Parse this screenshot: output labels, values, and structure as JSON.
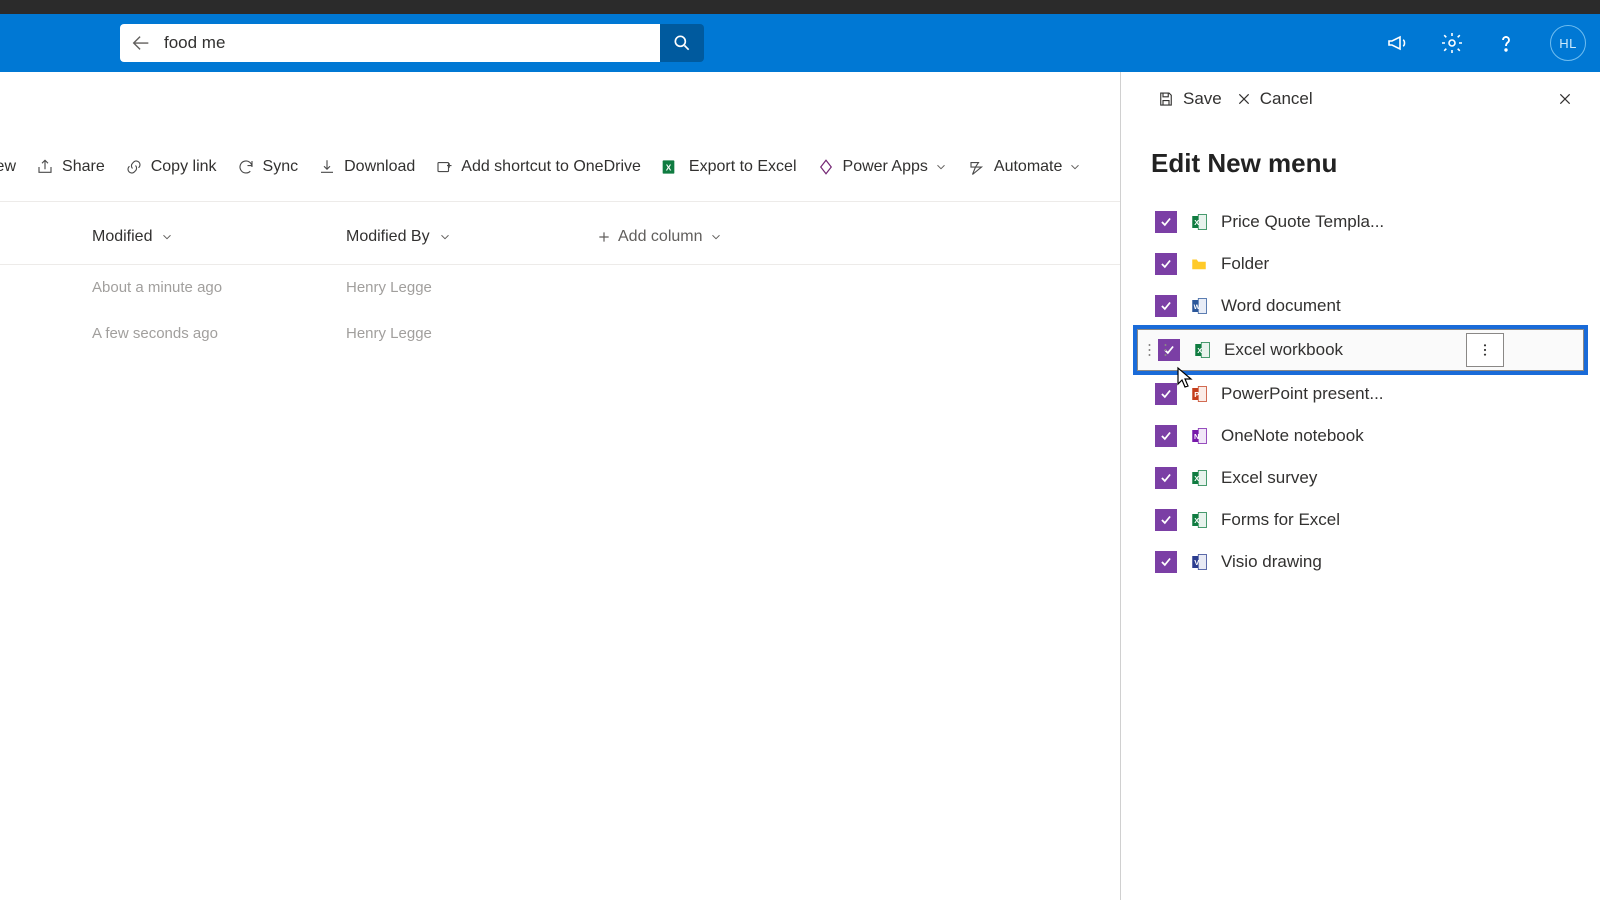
{
  "search": {
    "value": "food me"
  },
  "header": {
    "avatar": "HL"
  },
  "commands": {
    "view_partial": "iew",
    "share": "Share",
    "copy_link": "Copy link",
    "sync": "Sync",
    "download": "Download",
    "add_shortcut": "Add shortcut to OneDrive",
    "export_excel": "Export to Excel",
    "power_apps": "Power Apps",
    "automate": "Automate"
  },
  "columns": {
    "modified": "Modified",
    "modified_by": "Modified By",
    "add": "Add column"
  },
  "rows": [
    {
      "modified": "About a minute ago",
      "by": "Henry Legge"
    },
    {
      "modified": "A few seconds ago",
      "by": "Henry Legge"
    }
  ],
  "panel": {
    "save": "Save",
    "cancel": "Cancel",
    "title": "Edit New menu",
    "items": [
      {
        "label": "Price Quote Templa...",
        "icon": "excel"
      },
      {
        "label": "Folder",
        "icon": "folder"
      },
      {
        "label": "Word document",
        "icon": "word"
      },
      {
        "label": "Excel workbook",
        "icon": "excel",
        "highlight": true
      },
      {
        "label": "PowerPoint present...",
        "icon": "powerpoint"
      },
      {
        "label": "OneNote notebook",
        "icon": "onenote"
      },
      {
        "label": "Excel survey",
        "icon": "excel"
      },
      {
        "label": "Forms for Excel",
        "icon": "excel"
      },
      {
        "label": "Visio drawing",
        "icon": "visio"
      }
    ]
  }
}
